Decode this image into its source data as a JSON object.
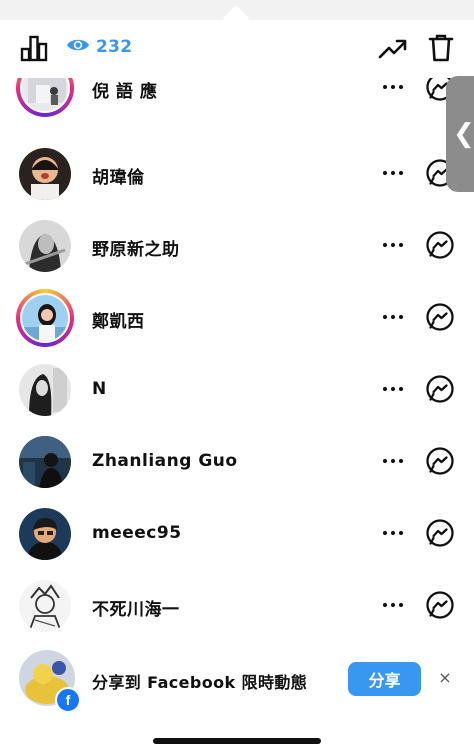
{
  "header": {
    "views_count": "232",
    "icons": [
      "bar-chart-icon",
      "eye-icon",
      "trending-icon",
      "trash-icon"
    ]
  },
  "viewers": [
    {
      "name": "倪 語 應",
      "ring": true
    },
    {
      "name": "胡瑋倫",
      "ring": false
    },
    {
      "name": "野原新之助",
      "ring": false
    },
    {
      "name": "鄭凱西",
      "ring": true
    },
    {
      "name": "N",
      "ring": false
    },
    {
      "name": "Zhanliang Guo",
      "ring": false
    },
    {
      "name": "meeec95",
      "ring": false
    },
    {
      "name": "不死川海一",
      "ring": false
    }
  ],
  "facebook_share": {
    "text": "分享到 Facebook 限時動態",
    "button_label": "分享",
    "close_label": "×"
  },
  "colors": {
    "accent": "#3897f0",
    "facebook": "#1877f2",
    "side_tab": "#8c8c8c"
  }
}
